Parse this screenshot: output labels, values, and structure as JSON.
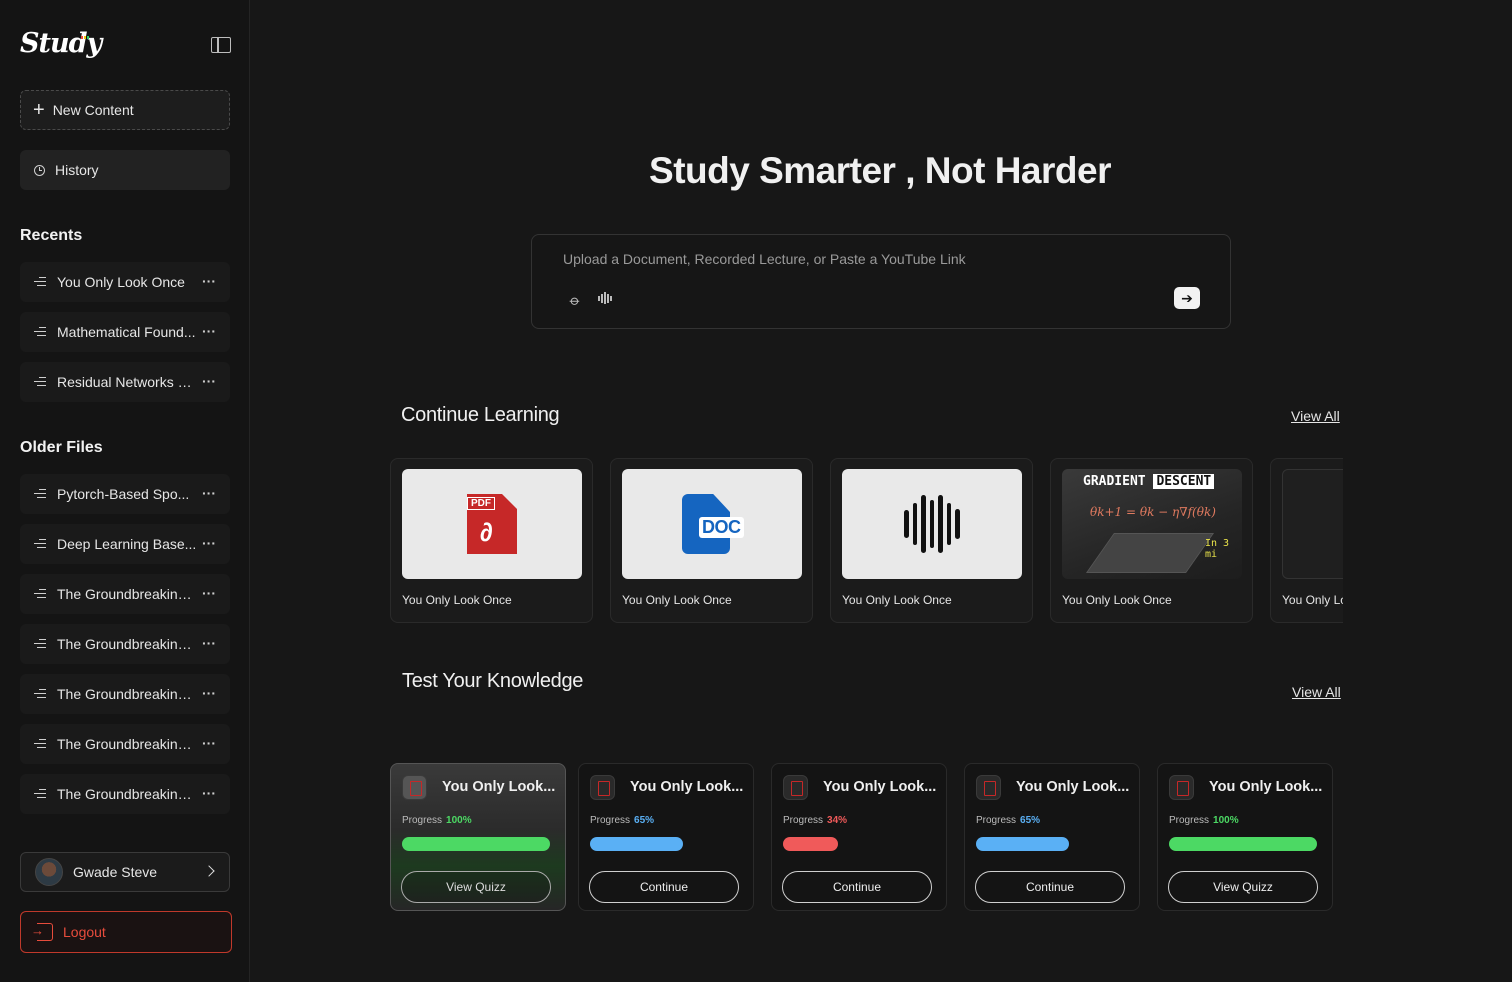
{
  "app": {
    "logo": "Study"
  },
  "sidebar": {
    "new_content": "New Content",
    "history": "History",
    "recents_title": "Recents",
    "recents": [
      "You Only Look Once",
      "Mathematical Found...",
      "Residual Networks a..."
    ],
    "older_title": "Older Files",
    "older": [
      "Pytorch-Based Spo...",
      "Deep Learning Base...",
      "The Groundbreaking...",
      "The Groundbreaking...",
      "The Groundbreaking...",
      "The Groundbreaking...",
      "The Groundbreaking..."
    ],
    "more_glyph": "···",
    "user_name": "Gwade Steve",
    "logout": "Logout"
  },
  "main": {
    "hero": "Study Smarter , Not Harder",
    "upload_placeholder": "Upload a Document, Recorded Lecture, or Paste a YouTube Link",
    "send_glyph": "➔",
    "continue": {
      "title": "Continue Learning",
      "view_all": "View All",
      "cards": [
        {
          "label": "You Only Look Once",
          "kind": "pdf",
          "badge": "PDF"
        },
        {
          "label": "You Only Look Once",
          "kind": "doc",
          "badge": "DOC"
        },
        {
          "label": "You Only Look Once",
          "kind": "audio"
        },
        {
          "label": "You Only Look Once",
          "kind": "video",
          "thumb_title_a": "GRADIENT",
          "thumb_title_b": "DESCENT",
          "thumb_eq": "θk+1 = θk − η∇f(θk)",
          "thumb_min": "In 3 mi"
        },
        {
          "label": "You Only Lo",
          "kind": "blank"
        }
      ]
    },
    "quiz": {
      "title": "Test Your Knowledge",
      "view_all": "View All",
      "progress_label": "Progress",
      "cards": [
        {
          "title": "You Only Look...",
          "progress": 100,
          "progress_text": "100%",
          "color": "#4cd964",
          "button": "View Quizz"
        },
        {
          "title": "You Only Look...",
          "progress": 65,
          "progress_text": "65%",
          "color": "#5ab0f5",
          "button": "Continue"
        },
        {
          "title": "You Only Look...",
          "progress": 34,
          "progress_text": "34%",
          "color": "#f05a5a",
          "button": "Continue"
        },
        {
          "title": "You Only Look...",
          "progress": 65,
          "progress_text": "65%",
          "color": "#5ab0f5",
          "button": "Continue"
        },
        {
          "title": "You Only Look...",
          "progress": 100,
          "progress_text": "100%",
          "color": "#4cd964",
          "button": "View Quizz"
        }
      ]
    }
  }
}
